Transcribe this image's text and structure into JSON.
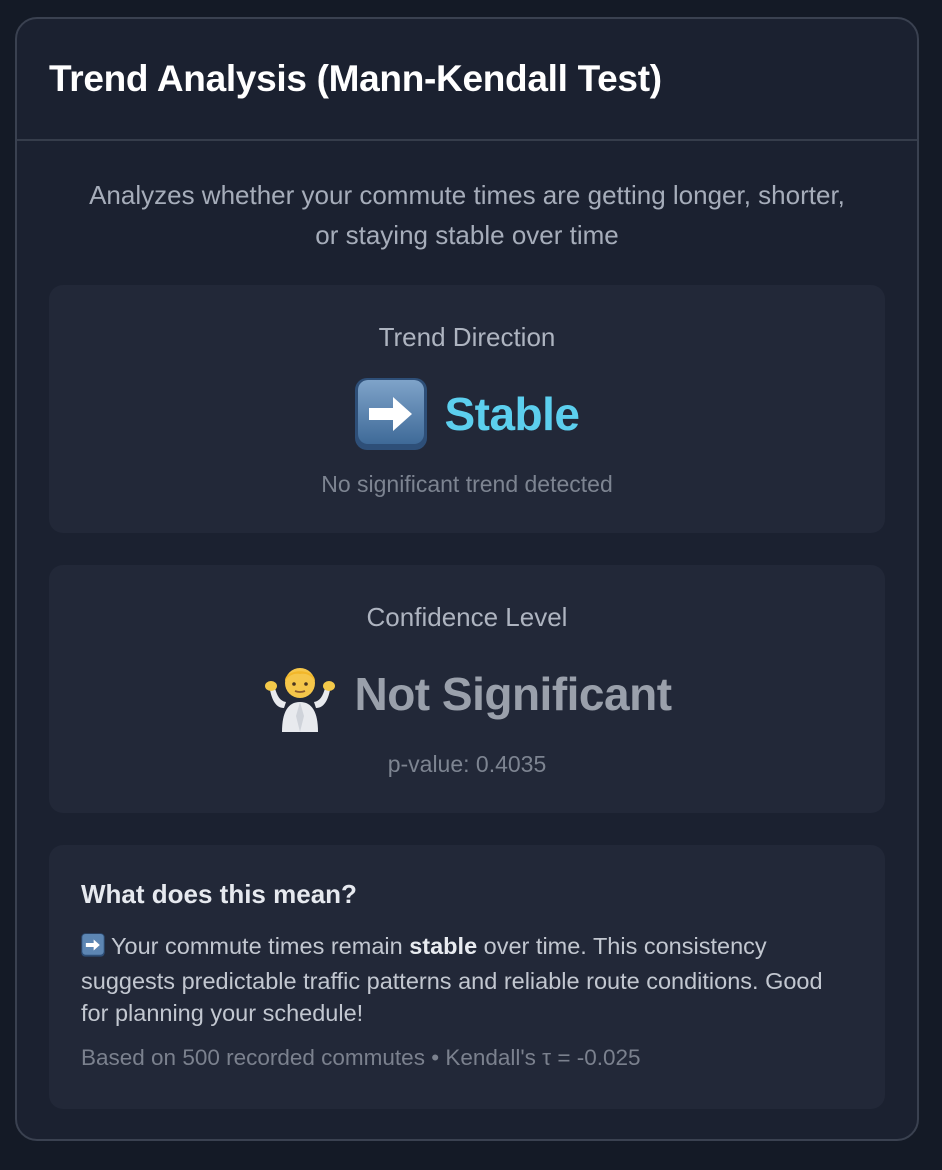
{
  "header": {
    "title": "Trend Analysis (Mann-Kendall Test)"
  },
  "description": "Analyzes whether your commute times are getting longer, shorter, or staying stable over time",
  "trend": {
    "label": "Trend Direction",
    "icon": "right-arrow-emoji-icon",
    "value": "Stable",
    "value_color": "#5ccfee",
    "subtext": "No significant trend detected"
  },
  "confidence": {
    "label": "Confidence Level",
    "icon": "shrug-emoji-icon",
    "value": "Not Significant",
    "value_color": "#9aa0ab",
    "subtext": "p-value: 0.4035"
  },
  "explanation": {
    "title": "What does this mean?",
    "icon": "right-arrow-emoji-icon",
    "text_before": "Your commute times remain ",
    "text_bold": "stable",
    "text_after": " over time. This consistency suggests predictable traffic patterns and reliable route conditions. Good for planning your schedule!",
    "footer": "Based on 500 recorded commutes • Kendall's τ = -0.025"
  },
  "colors": {
    "background": "#141a26",
    "card": "#1b2130",
    "panel": "#222838",
    "accent": "#5ccfee"
  }
}
